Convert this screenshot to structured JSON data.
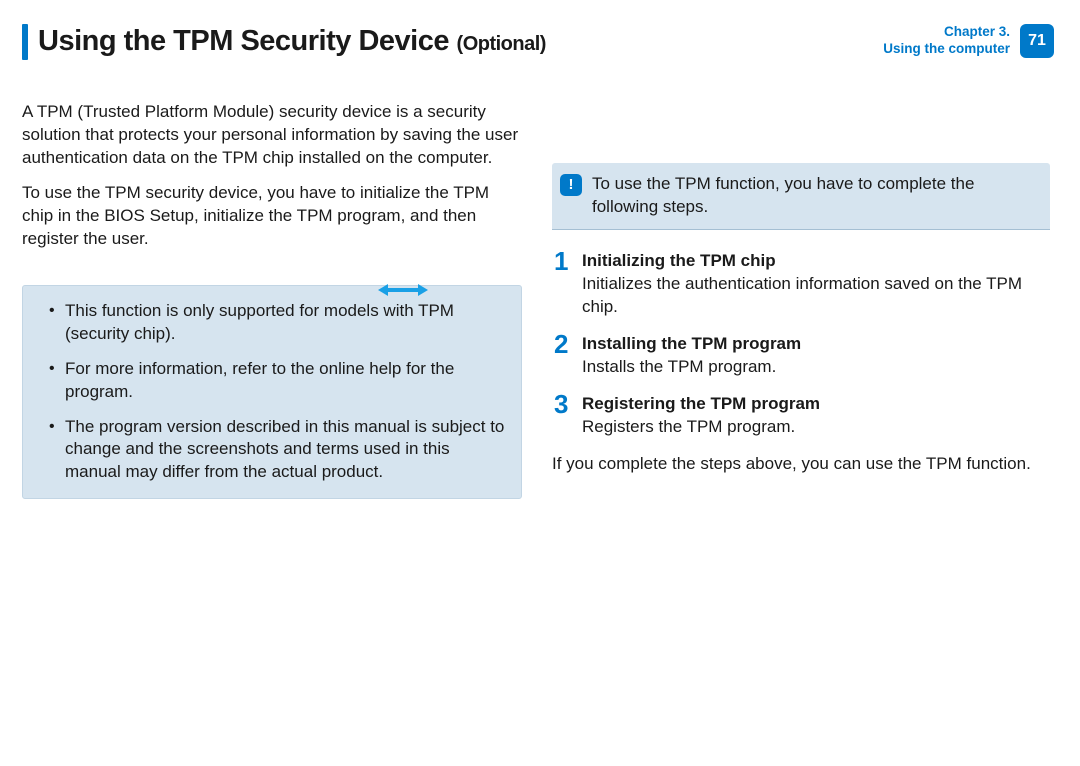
{
  "header": {
    "title_main": "Using the TPM Security Device",
    "title_suffix": "(Optional)",
    "chapter_line1": "Chapter 3.",
    "chapter_line2": "Using the computer",
    "page_number": "71"
  },
  "left_column": {
    "para1": "A TPM (Trusted Platform Module) security device is a security solution that protects your personal information by saving the user authentication data on the TPM chip installed on the computer.",
    "para2": "To use the TPM security device, you have to initialize the TPM chip in the BIOS Setup, initialize the TPM program, and then register the user.",
    "notes": [
      "This function is only supported for models with TPM (security chip).",
      "For more information, refer to the online help for the program.",
      "The program version described in this manual is subject to change and the screenshots and terms used in this manual may differ from the actual product."
    ]
  },
  "right_column": {
    "alert_icon_label": "!",
    "alert_text": "To use the TPM function, you have to complete the following steps.",
    "steps": [
      {
        "num": "1",
        "title": "Initializing the TPM chip",
        "desc": "Initializes the authentication information saved on the TPM chip."
      },
      {
        "num": "2",
        "title": "Installing the TPM program",
        "desc": "Installs the TPM program."
      },
      {
        "num": "3",
        "title": "Registering the TPM program",
        "desc": "Registers the TPM program."
      }
    ],
    "closing": "If you complete the steps above, you can use the TPM function."
  }
}
